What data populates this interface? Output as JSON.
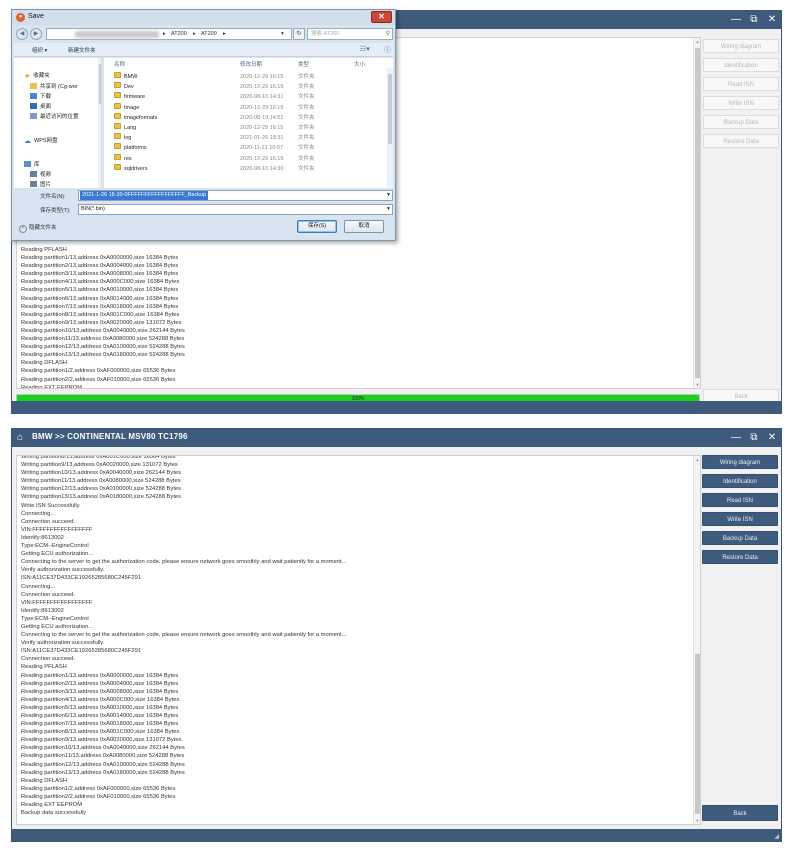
{
  "top_window": {
    "win_controls": [
      "—",
      "⧉",
      "✕"
    ],
    "side_buttons": [
      "Wiring diagram",
      "Identification",
      "Read  ISN",
      "Write  ISN",
      "Backup Data",
      "Restore Data"
    ],
    "back_label": "Back",
    "progress": {
      "percent": 100,
      "label": "100%"
    },
    "log": [
      "Reading PFLASH",
      "Reading partition1/13,address 0xA0000000,size 16384 Bytes",
      "Reading partition2/13,address 0xA0004000,size 16384 Bytes",
      "Reading partition3/13,address 0xA0008000,size 16384 Bytes",
      "Reading partition4/13,address 0xA000C000,size 16384 Bytes",
      "Reading partition5/13,address 0xA0010000,size 16384 Bytes",
      "Reading partition6/13,address 0xA0014000,size 16384 Bytes",
      "Reading partition7/13,address 0xA0018000,size 16384 Bytes",
      "Reading partition8/13,address 0xA001C000,size 16384 Bytes",
      "Reading partition9/13,address 0xA0020000,size 131072 Bytes",
      "Reading partition10/13,address 0xA0040000,size 262144 Bytes",
      "Reading partition11/13,address 0xA0080000,size 524288 Bytes",
      "Reading partition12/13,address 0xA0100000,size 524288 Bytes",
      "Reading partition13/13,address 0xA0180000,size 524288 Bytes",
      "Reading DFLASH",
      "Reading partition1/2,address 0xAF000000,size 65536 Bytes",
      "Reading partition2/2,address 0xAF010000,size 65536 Bytes",
      "Reading EXT EEPROM"
    ]
  },
  "save_dialog": {
    "title": "Save",
    "path": [
      "AT200",
      "AT200"
    ],
    "search_placeholder": "搜索 AT200",
    "toolbar": {
      "organize": "组织 ▾",
      "new_folder": "新建文件夹"
    },
    "nav_items": [
      {
        "label": "收藏夹",
        "icon": "star-icon"
      },
      {
        "label": "共享到 (Cg-wor",
        "icon": "folder-icon"
      },
      {
        "label": "下载",
        "icon": "folder-icon"
      },
      {
        "label": "桌面",
        "icon": "folder-icon"
      },
      {
        "label": "最近访问的位置",
        "icon": "folder-icon"
      },
      {
        "label": "WPS网盘",
        "icon": "cloud-icon"
      },
      {
        "label": "库",
        "icon": "library-icon"
      },
      {
        "label": "视频",
        "icon": "folder-icon"
      },
      {
        "label": "图片",
        "icon": "folder-icon"
      }
    ],
    "columns": [
      "名称",
      "修改日期",
      "类型",
      "大小"
    ],
    "files": [
      {
        "name": "BMW",
        "date": "2020-12-29 16:15",
        "type": "文件夹"
      },
      {
        "name": "Dev",
        "date": "2020-12-29 16:15",
        "type": "文件夹"
      },
      {
        "name": "firmware",
        "date": "2020-08-10 14:31",
        "type": "文件夹"
      },
      {
        "name": "Image",
        "date": "2020-12-29 16:15",
        "type": "文件夹"
      },
      {
        "name": "imageformats",
        "date": "2020-08-10 14:51",
        "type": "文件夹"
      },
      {
        "name": "Lang",
        "date": "2020-12-29 16:15",
        "type": "文件夹"
      },
      {
        "name": "log",
        "date": "2021-01-26 18:31",
        "type": "文件夹"
      },
      {
        "name": "platforms",
        "date": "2020-11-21 10:07",
        "type": "文件夹"
      },
      {
        "name": "res",
        "date": "2020-12-29 16:15",
        "type": "文件夹"
      },
      {
        "name": "sqldrivers",
        "date": "2020-08-10 14:30",
        "type": "文件夹"
      }
    ],
    "filename_label": "文件名(N):",
    "filename_value": "2021-1-26 18-30-0FFFFFFFFFFFFFFFFF_Backup",
    "filetype_label": "保存类型(T):",
    "filetype_value": "BIN(*.bin)",
    "hide_folders": "隐藏文件夹",
    "save_button": "保存(S)",
    "cancel_button": "取消"
  },
  "bottom_window": {
    "title": "BMW >> CONTINENTAL MSV80 TC1796",
    "win_controls": [
      "—",
      "⧉",
      "✕"
    ],
    "side_buttons": [
      "Wiring diagram",
      "Identification",
      "Read  ISN",
      "Write  ISN",
      "Backup Data",
      "Restore Data"
    ],
    "back_label": "Back",
    "log": [
      "Writing partition8/13,address 0xA001C000,size 16384 Bytes",
      "Writing partition9/13,address 0xA0020000,size 131072 Bytes",
      "Writing partition10/13,address 0xA0040000,size 262144 Bytes",
      "Writing partition11/13,address 0xA0080000,size 524288 Bytes",
      "Writing partition12/13,address 0xA0100000,size 524288 Bytes",
      "Writing partition13/13,address 0xA0180000,size 524288 Bytes",
      "Write ISN Successfully.",
      "Connecting...",
      "Connection succeed.",
      "VIN:FFFFFFFFFFFFFFFFF",
      "Identify:8613002",
      "Type:ECM--EngineControl",
      "Getting ECU authorization...",
      "Connecting to the server to get the authorization code, please ensure network goes smoothly and wait patiently for a moment...",
      "Verify authorization successfully.",
      "ISN:A11CE37D433CE19265285680C245F291",
      "Connecting...",
      "Connection succeed.",
      "VIN:FFFFFFFFFFFFFFFFF",
      "Identify:8613002",
      "Type:ECM--EngineControl",
      "Getting ECU authorization...",
      "Connecting to the server to get the authorization code, please ensure network goes smoothly and wait patiently for a moment...",
      "Verify authorization successfully.",
      "ISN:A11CE37D433CE19265285680C245F291",
      "Connection succeed.",
      "Reading PFLASH",
      "Reading partition1/13,address 0xA0000000,size 16384 Bytes",
      "Reading partition2/13,address 0xA0004000,size 16384 Bytes",
      "Reading partition3/13,address 0xA0008000,size 16384 Bytes",
      "Reading partition4/13,address 0xA000C000,size 16384 Bytes",
      "Reading partition5/13,address 0xA0010000,size 16384 Bytes",
      "Reading partition6/13,address 0xA0014000,size 16384 Bytes",
      "Reading partition7/13,address 0xA0018000,size 16384 Bytes",
      "Reading partition8/13,address 0xA001C000,size 16384 Bytes",
      "Reading partition9/13,address 0xA0020000,size 131072 Bytes",
      "Reading partition10/13,address 0xA0040000,size 262144 Bytes",
      "Reading partition11/13,address 0xA0080000,size 524288 Bytes",
      "Reading partition12/13,address 0xA0100000,size 524288 Bytes",
      "Reading partition13/13,address 0xA0180000,size 524288 Bytes",
      "Reading DFLASH",
      "Reading partition1/2,address 0xAF000000,size 65536 Bytes",
      "Reading partition2/2,address 0xAF010000,size 65536 Bytes",
      "Reading EXT EEPROM",
      "Backup data successfully"
    ]
  }
}
